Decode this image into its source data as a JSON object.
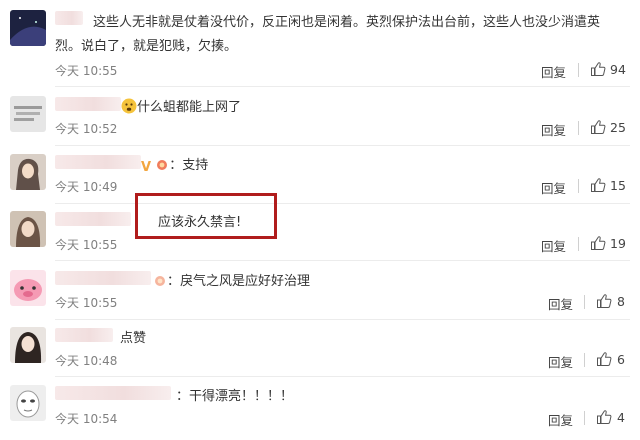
{
  "comments": [
    {
      "avatar": "dark-space-avatar",
      "text_line1": "这些人无非就是仗着没代价，反正闲也是闲着。英烈保护法出台前，这些人也没少消遣英",
      "text_line2": "烈。说白了，就是犯贱，欠揍。",
      "time": "今天 10:55",
      "reply": "回复",
      "likes": "94"
    },
    {
      "avatar": "text-graphic-avatar",
      "text": "什么蛆都能上网了",
      "time": "今天 10:52",
      "reply": "回复",
      "likes": "25"
    },
    {
      "avatar": "girl-photo-avatar",
      "text": "支持",
      "colon": "：",
      "time": "今天 10:49",
      "reply": "回复",
      "likes": "15"
    },
    {
      "avatar": "girl-photo-avatar",
      "text": "应该永久禁言!",
      "time": "今天 10:55",
      "reply": "回复",
      "likes": "19"
    },
    {
      "avatar": "pink-cartoon-avatar",
      "text": "戾气之风是应好好治理",
      "colon": "：",
      "time": "今天 10:55",
      "reply": "回复",
      "likes": "8"
    },
    {
      "avatar": "girl-photo-avatar",
      "text": "点赞",
      "time": "今天 10:48",
      "reply": "回复",
      "likes": "6"
    },
    {
      "avatar": "face-mask-avatar",
      "text": "干得漂亮！！！！",
      "colon": "：",
      "time": "今天 10:54",
      "reply": "回复",
      "likes": "4"
    }
  ],
  "colors": {
    "highlight": "#b01c1c",
    "text": "#333333",
    "muted": "#808080"
  }
}
